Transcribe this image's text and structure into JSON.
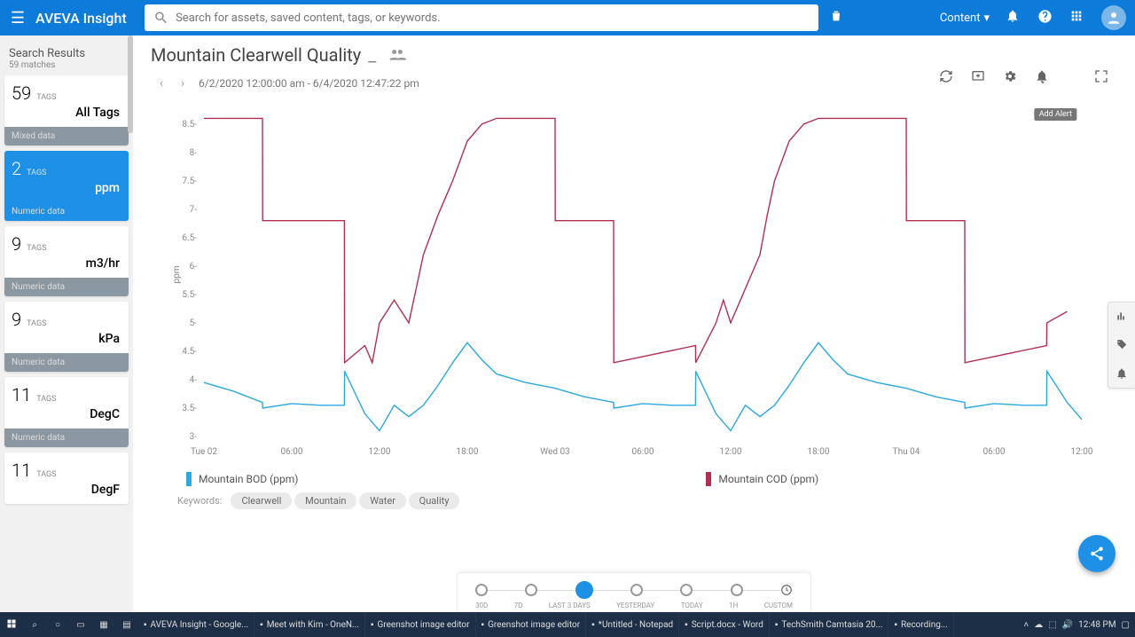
{
  "header": {
    "brand": "AVEVA Insight",
    "search_placeholder": "Search for assets, saved content, tags, or keywords.",
    "content_label": "Content"
  },
  "sidebar": {
    "title": "Search Results",
    "matches": "59 matches",
    "cards": [
      {
        "count": "59",
        "unit": "All Tags",
        "foot": "Mixed data",
        "active": false
      },
      {
        "count": "2",
        "unit": "ppm",
        "foot": "Numeric data",
        "active": true
      },
      {
        "count": "9",
        "unit": "m3/hr",
        "foot": "Numeric data",
        "active": false
      },
      {
        "count": "9",
        "unit": "kPa",
        "foot": "Numeric data",
        "active": false
      },
      {
        "count": "11",
        "unit": "DegC",
        "foot": "Numeric data",
        "active": false
      },
      {
        "count": "11",
        "unit": "DegF",
        "foot": "",
        "active": false
      }
    ],
    "tags_label": "TAGS"
  },
  "page": {
    "title": "Mountain Clearwell Quality",
    "date_range": "6/2/2020 12:00:00 am - 6/4/2020 12:47:22 pm",
    "tooltip_add_alert": "Add Alert",
    "ylabel": "ppm"
  },
  "legend": {
    "series1": "Mountain BOD (ppm)",
    "series2": "Mountain COD (ppm)"
  },
  "keywords": {
    "label": "Keywords:",
    "chips": [
      "Clearwell",
      "Mountain",
      "Water",
      "Quality"
    ]
  },
  "time_selector": {
    "labels": [
      "30D",
      "7D",
      "LAST 3 DAYS",
      "YESTERDAY",
      "TODAY",
      "1H",
      "CUSTOM"
    ],
    "active_index": 2
  },
  "taskbar": {
    "items": [
      {
        "label": "AVEVA Insight - Google..."
      },
      {
        "label": "Meet with Kim - OneN..."
      },
      {
        "label": "Greenshot image editor"
      },
      {
        "label": "Greenshot image editor"
      },
      {
        "label": "*Untitled - Notepad"
      },
      {
        "label": "Script.docx - Word"
      },
      {
        "label": "TechSmith Camtasia 20..."
      },
      {
        "label": "Recording..."
      }
    ],
    "clock": "12:48 PM"
  },
  "chart_data": {
    "type": "line",
    "xlabel": "",
    "ylabel": "ppm",
    "ylim": [
      3,
      8.7
    ],
    "x_ticks": [
      "Tue 02",
      "06:00",
      "12:00",
      "18:00",
      "Wed 03",
      "06:00",
      "12:00",
      "18:00",
      "Thu 04",
      "06:00",
      "12:00"
    ],
    "y_ticks": [
      3,
      3.5,
      4,
      4.5,
      5,
      5.5,
      6,
      6.5,
      7,
      7.5,
      8,
      8.5
    ],
    "series": [
      {
        "name": "Mountain COD (ppm)",
        "color": "#b13052",
        "x": [
          0,
          4,
          4.01,
          9.6,
          9.61,
          11,
          11.5,
          12,
          13,
          14,
          14.5,
          15,
          16,
          17,
          18,
          19,
          20,
          24,
          24.01,
          28,
          28.01,
          33.6,
          33.61,
          35,
          35.5,
          36,
          37,
          38,
          38.5,
          39,
          40,
          41,
          42,
          43,
          44,
          48,
          48.01,
          52,
          52.01,
          57.6,
          57.61,
          59,
          60
        ],
        "values": [
          8.6,
          8.6,
          6.8,
          6.8,
          4.3,
          4.6,
          4.3,
          5.0,
          5.4,
          5.0,
          5.6,
          6.2,
          6.9,
          7.5,
          8.2,
          8.5,
          8.6,
          8.6,
          6.8,
          6.8,
          4.3,
          4.6,
          4.3,
          5.0,
          5.4,
          5.0,
          5.6,
          6.2,
          6.9,
          7.5,
          8.2,
          8.5,
          8.6,
          8.6,
          8.6,
          8.6,
          6.8,
          6.8,
          4.3,
          4.6,
          5.0,
          5.2
        ]
      },
      {
        "name": "Mountain BOD (ppm)",
        "color": "#2ca8df",
        "x": [
          0,
          2,
          4,
          4.01,
          6,
          8,
          9.6,
          9.61,
          11,
          12,
          13,
          14,
          15,
          16,
          17,
          18,
          19,
          20,
          22,
          24,
          26,
          28,
          28.01,
          30,
          32,
          33.6,
          33.61,
          35,
          36,
          37,
          38,
          39,
          40,
          41,
          42,
          43,
          44,
          46,
          48,
          50,
          52,
          52.01,
          54,
          56,
          57.6,
          57.61,
          59,
          60
        ],
        "values": [
          3.95,
          3.8,
          3.6,
          3.5,
          3.58,
          3.55,
          3.55,
          4.15,
          3.4,
          3.1,
          3.55,
          3.35,
          3.55,
          3.9,
          4.3,
          4.65,
          4.35,
          4.1,
          3.95,
          3.85,
          3.7,
          3.6,
          3.5,
          3.58,
          3.55,
          3.55,
          4.15,
          3.4,
          3.1,
          3.55,
          3.35,
          3.55,
          3.9,
          4.3,
          4.65,
          4.35,
          4.1,
          3.95,
          3.85,
          3.7,
          3.6,
          3.5,
          3.58,
          3.55,
          3.55,
          4.15,
          3.6,
          3.3
        ]
      }
    ]
  }
}
